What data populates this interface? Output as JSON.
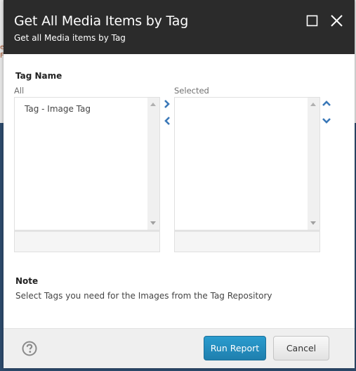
{
  "backdrop": {
    "fragment_text": "e\nF"
  },
  "dialog": {
    "title": "Get All Media Items by Tag",
    "subtitle": "Get all Media items by Tag",
    "controls": {
      "maximize_icon": "maximize-icon",
      "close_icon": "close-icon"
    }
  },
  "form": {
    "field_label": "Tag Name",
    "all_list": {
      "label": "All",
      "items": [
        "Tag - Image Tag"
      ],
      "filter_value": ""
    },
    "selected_list": {
      "label": "Selected",
      "items": [],
      "filter_value": ""
    },
    "transfer_buttons": {
      "move_right_icon": "chevron-right-icon",
      "move_left_icon": "chevron-left-icon",
      "move_up_icon": "chevron-up-icon",
      "move_down_icon": "chevron-down-icon"
    }
  },
  "note": {
    "title": "Note",
    "text": "Select Tags you need for the Images from the Tag Repository"
  },
  "footer": {
    "help_icon": "question-circle-icon",
    "run_report_label": "Run Report",
    "cancel_label": "Cancel"
  },
  "colors": {
    "header_bg": "#2b2b2b",
    "primary_button": "#2a8fc0",
    "arrow_icon": "#3a78b8",
    "backdrop_dark": "#2d4a6b"
  }
}
